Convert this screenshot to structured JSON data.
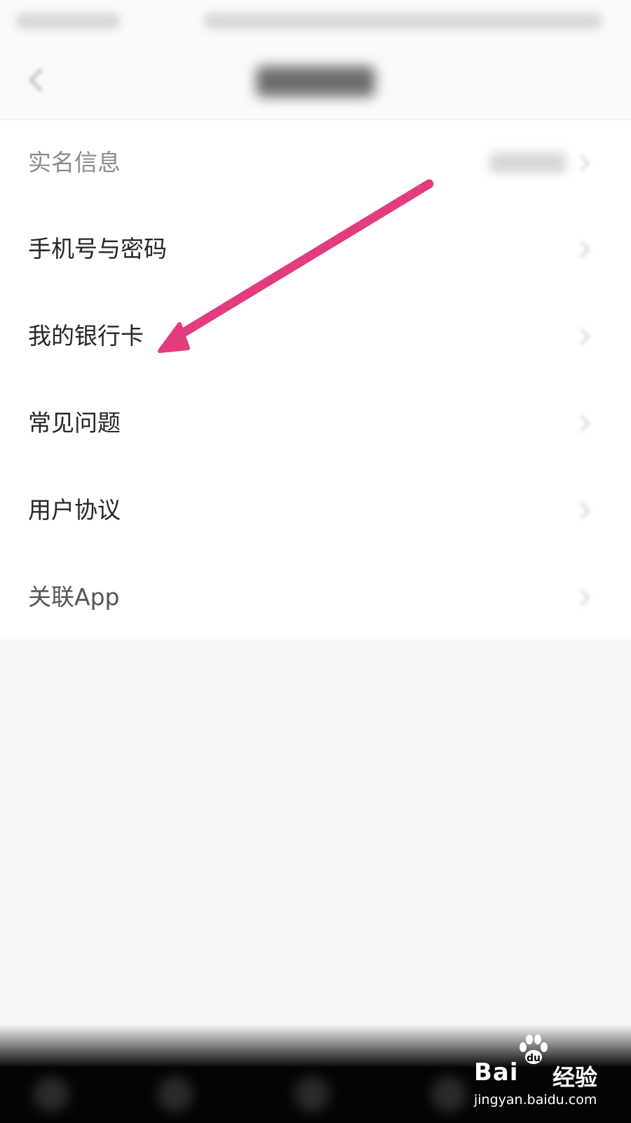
{
  "menu": {
    "items": [
      {
        "label": "实名信息",
        "state": "blurred"
      },
      {
        "label": "手机号与密码"
      },
      {
        "label": "我的银行卡"
      },
      {
        "label": "常见问题"
      },
      {
        "label": "用户协议"
      },
      {
        "label": "关联App"
      }
    ]
  },
  "annotation": {
    "arrow_color": "#e23c7e",
    "points_to": "我的银行卡"
  },
  "watermark": {
    "brand": "Bai  经验",
    "brand_left": "Bai",
    "brand_right": "经验",
    "url": "jingyan.baidu.com"
  },
  "colors": {
    "background": "#f6f6f6",
    "menu_background": "#ffffff",
    "bottom_bar": "#050505"
  }
}
